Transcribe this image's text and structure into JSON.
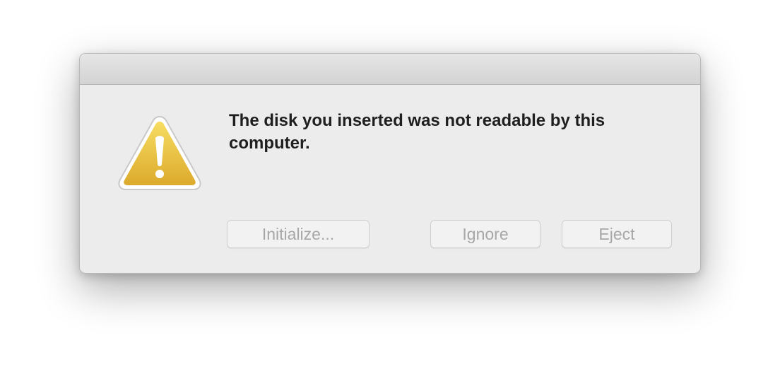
{
  "dialog": {
    "message": "The disk you inserted was not readable by this computer.",
    "icon": "warning-icon",
    "buttons": {
      "initialize": "Initialize...",
      "ignore": "Ignore",
      "eject": "Eject"
    }
  },
  "colors": {
    "icon_gold": "#e3b93a",
    "disabled_text": "#a7a7a7",
    "dialog_bg": "#ececec"
  }
}
